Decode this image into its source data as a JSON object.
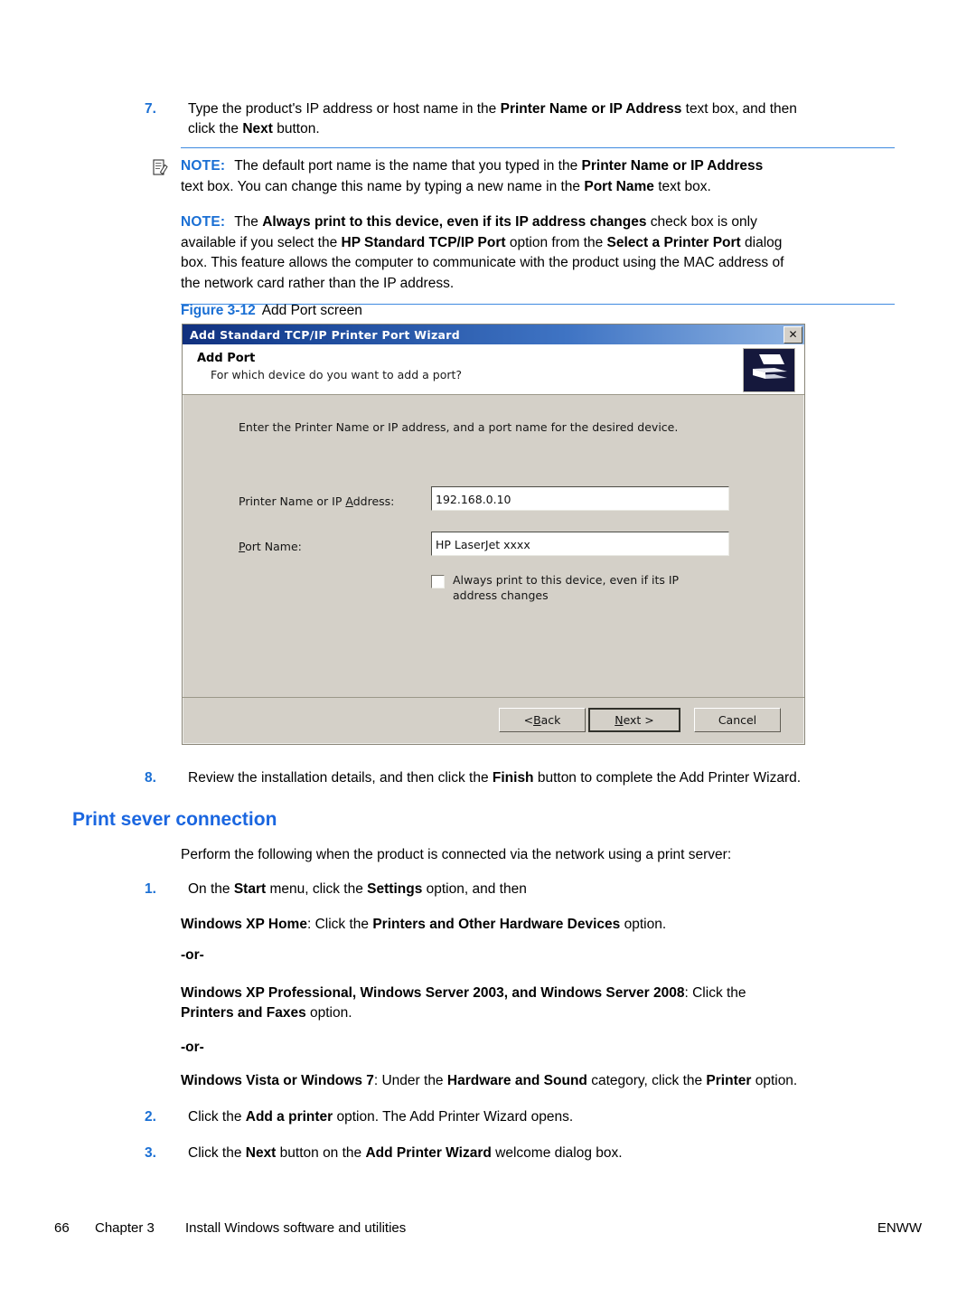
{
  "document": {
    "steps": {
      "step7": {
        "number": "7.",
        "line1_a": "Type the product's IP address or host name in the ",
        "line1_b": "Printer Name or IP Address",
        "line1_c": " text box, and then",
        "line2_a": "click the ",
        "line2_b": "Next",
        "line2_c": " button."
      },
      "step8": {
        "number": "8.",
        "text_a": "Review the installation details, and then click the ",
        "text_b": "Finish",
        "text_c": " button to complete the Add Printer Wizard."
      },
      "step1": {
        "number": "1.",
        "text_a": "On the ",
        "text_b": "Start",
        "text_c": " menu, click the ",
        "text_d": "Settings",
        "text_e": " option, and then"
      },
      "step2": {
        "number": "2.",
        "text_a": "Click the ",
        "text_b": "Add a printer",
        "text_c": " option. The Add Printer Wizard opens."
      },
      "step3": {
        "number": "3.",
        "text_a": "Click the ",
        "text_b": "Next",
        "text_c": " button on the ",
        "text_d": "Add Printer Wizard",
        "text_e": " welcome dialog box."
      }
    },
    "notes": {
      "label": "NOTE:",
      "note1": {
        "line1_a": "The default port name is the name that you typed in the ",
        "line1_b": "Printer Name or IP Address",
        "line2_a": "text box. You can change this name by typing a new name in the ",
        "line2_b": "Port Name",
        "line2_c": " text box."
      },
      "note2": {
        "p1_a": "The ",
        "p1_b": "Always print to this device, even if its IP address changes",
        "p1_c": " check box is only",
        "p2_a": "available if you select the ",
        "p2_b": "HP Standard TCP/IP Port",
        "p2_c": " option from the ",
        "p2_d": "Select a Printer Port",
        "p2_e": " dialog",
        "p3": "box. This feature allows the computer to communicate with the product using the MAC address of",
        "p4": "the network card rather than the IP address."
      }
    },
    "figure": {
      "number": "Figure 3-12",
      "title": "Add Port screen"
    },
    "dialog": {
      "titlebar": "Add Standard TCP/IP Printer Port Wizard",
      "close_label": "✕",
      "header_title": "Add Port",
      "header_subtitle": "For which device do you want to add a port?",
      "intro": "Enter the Printer Name or IP address, and a port name for the desired device.",
      "fields": [
        {
          "label_pre": "Printer Name or IP ",
          "label_acc": "A",
          "label_post": "ddress:",
          "value": "192.168.0.10"
        },
        {
          "label_pre": "",
          "label_acc": "P",
          "label_post": "ort Name:",
          "value": "HP LaserJet xxxx"
        }
      ],
      "checkbox": {
        "label": "Always print to this device, even if its IP address changes",
        "checked": false
      },
      "buttons": {
        "back_pre": "< ",
        "back_acc": "B",
        "back_post": "ack",
        "next_acc": "N",
        "next_post": "ext >",
        "cancel": "Cancel"
      }
    },
    "heading": "Print sever connection",
    "intro_paragraph": "Perform the following when the product is connected via the network using a print server:",
    "variants": {
      "xp_home_a": "Windows XP Home",
      "xp_home_b": ": Click the ",
      "xp_home_c": "Printers and Other Hardware Devices",
      "xp_home_d": " option.",
      "or1": "-or-",
      "xp_pro_a": "Windows XP Professional, Windows Server 2003, and Windows Server 2008",
      "xp_pro_b": ": Click the",
      "xp_pro_c": "Printers and Faxes",
      "xp_pro_d": " option.",
      "or2": "-or-",
      "vista_a": "Windows Vista or Windows 7",
      "vista_b": ": Under the ",
      "vista_c": "Hardware and Sound",
      "vista_d": " category, click the ",
      "vista_e": "Printer",
      "vista_f": " option."
    },
    "footer": {
      "page_number": "66",
      "chapter": "Chapter 3",
      "chapter_title": "Install Windows software and utilities",
      "locale": "ENWW"
    },
    "colors": {
      "accent_blue": "#1a6fd4",
      "heading_blue": "#1a66e0",
      "dialog_bg": "#d4d0c8",
      "titlebar_start": "#11307e",
      "titlebar_end": "#8fb4e3"
    }
  }
}
